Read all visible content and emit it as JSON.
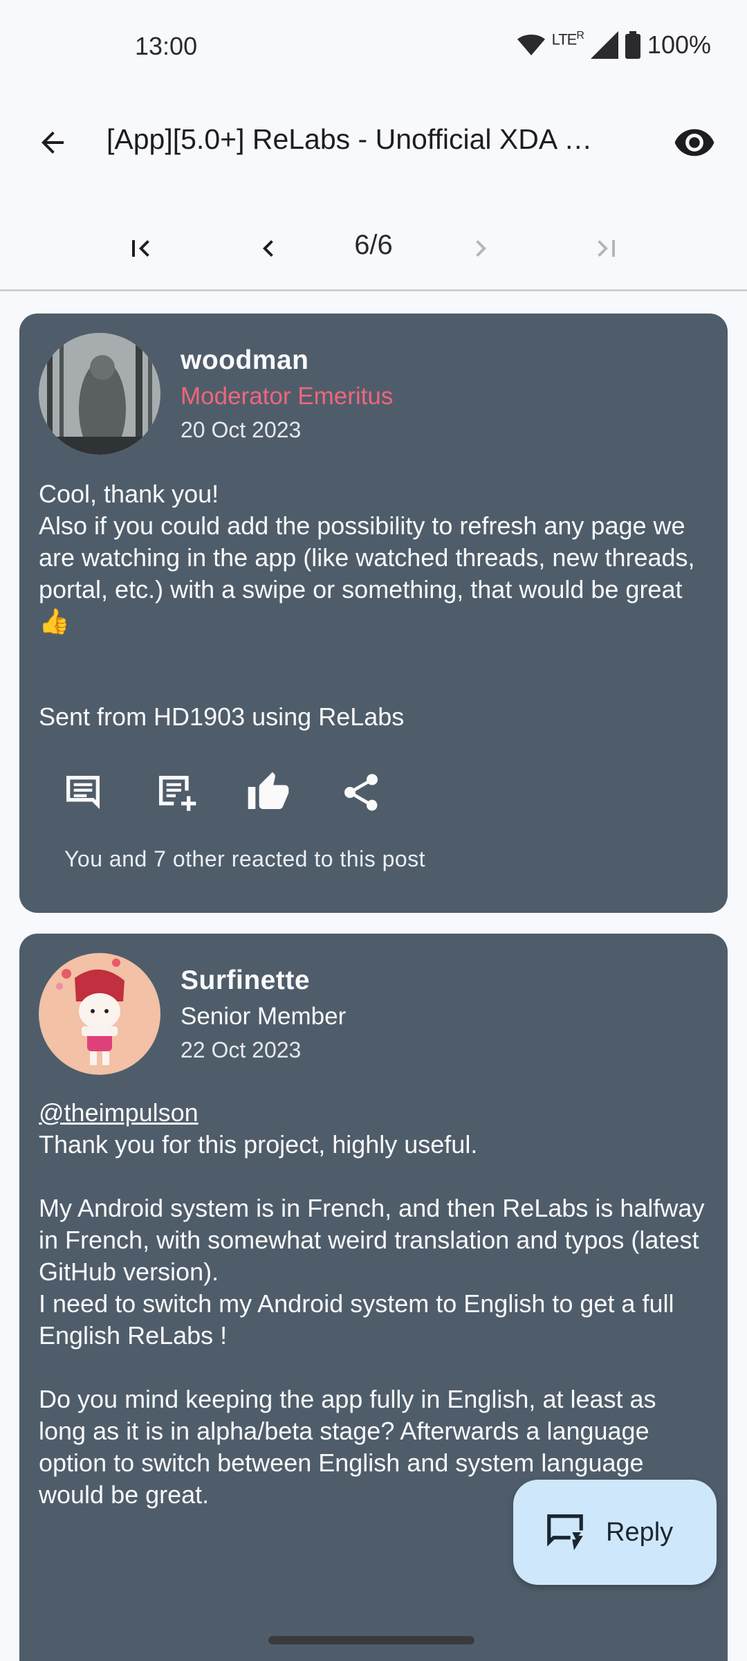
{
  "status": {
    "time": "13:00",
    "network": "LTE",
    "roaming": "R",
    "battery": "100%"
  },
  "app_bar": {
    "title": "[App][5.0+] ReLabs - Unofficial XDA …"
  },
  "pager": {
    "label": "6/6"
  },
  "posts": [
    {
      "username": "woodman",
      "role": "Moderator Emeritus",
      "date": "20 Oct 2023",
      "body": [
        "Cool, thank you!",
        "Also if you could add the possibility to refresh any page we are watching in the app (like watched threads, new threads, portal, etc.) with a swipe or something, that would be great 👍",
        "",
        "",
        "Sent from HD1903 using ReLabs"
      ],
      "reactions": "You and 7 other reacted to this post"
    },
    {
      "username": "Surfinette",
      "role": "Senior Member",
      "date": "22 Oct 2023",
      "mention": "@theimpulson",
      "body": [
        "Thank you for this project, highly useful.",
        "",
        "My Android system is in French, and then ReLabs is halfway in French, with somewhat weird translation and typos (latest GitHub version).",
        "I need to switch my Android system to English to get a full English ReLabs !",
        "",
        "Do you mind keeping the app fully in English, at least as long as it is in alpha/beta stage? Afterwards a language option to switch between English and system language would be great."
      ]
    }
  ],
  "fab": {
    "label": "Reply"
  },
  "colors": {
    "card": "#4f5d6b",
    "moderator": "#f0667a",
    "fab": "#cfe7fb"
  }
}
